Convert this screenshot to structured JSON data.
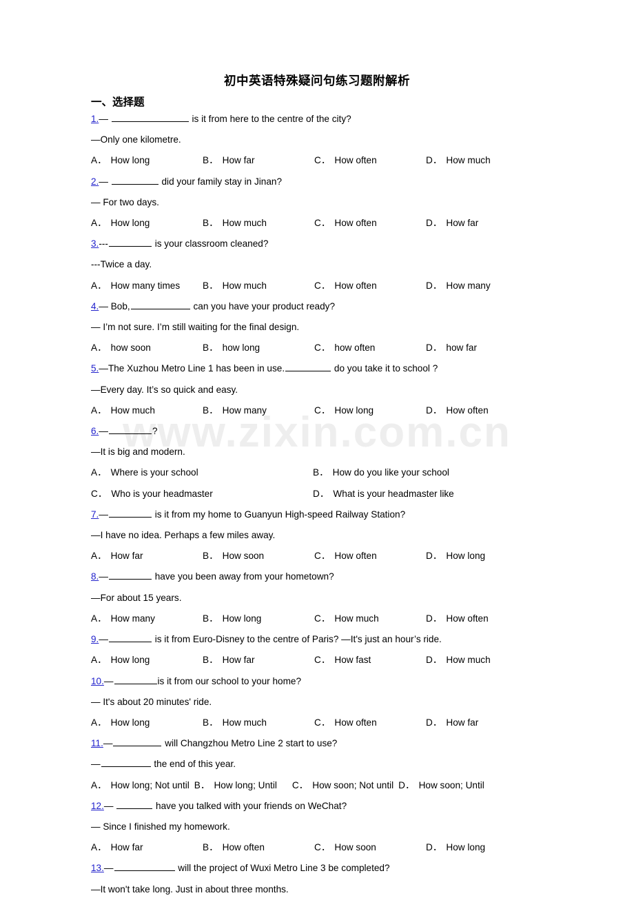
{
  "document": {
    "title": "初中英语特殊疑问句练习题附解析",
    "section_heading": "一、选择题",
    "watermark": "www.zixin.com.cn"
  },
  "questions": [
    {
      "num": "1.",
      "stem_pre": "— ",
      "stem_post": " is it from here to the centre of the city?",
      "reply": "—Only one kilometre.",
      "options": [
        {
          "label": "A．",
          "text": "How long"
        },
        {
          "label": "B．",
          "text": "How far"
        },
        {
          "label": "C．",
          "text": "How often"
        },
        {
          "label": "D．",
          "text": "How much"
        }
      ]
    },
    {
      "num": "2.",
      "stem_pre": "— ",
      "stem_post": " did your family stay in Jinan?",
      "reply": "— For two days.",
      "options": [
        {
          "label": "A．",
          "text": "How long"
        },
        {
          "label": "B．",
          "text": "How much"
        },
        {
          "label": "C．",
          "text": "How often"
        },
        {
          "label": "D．",
          "text": "How far"
        }
      ]
    },
    {
      "num": "3.",
      "stem_pre": "---",
      "stem_post": " is your classroom cleaned?",
      "reply": "---Twice a day.",
      "options": [
        {
          "label": "A．",
          "text": "How many times"
        },
        {
          "label": "B．",
          "text": "How much"
        },
        {
          "label": "C．",
          "text": "How often"
        },
        {
          "label": "D．",
          "text": "How many"
        }
      ]
    },
    {
      "num": "4.",
      "stem_pre": "— Bob,",
      "stem_post": " can you have your product ready?",
      "reply": "— I’m not sure. I’m still waiting for the final design.",
      "options": [
        {
          "label": "A．",
          "text": "how soon"
        },
        {
          "label": "B．",
          "text": "how long"
        },
        {
          "label": "C．",
          "text": "how often"
        },
        {
          "label": "D．",
          "text": "how far"
        }
      ]
    },
    {
      "num": "5.",
      "stem_pre": "—The Xuzhou Metro Line 1 has been in use.",
      "stem_post": " do you take it to school ?",
      "reply": "—Every day. It’s so quick and easy.",
      "options": [
        {
          "label": "A．",
          "text": "How much"
        },
        {
          "label": "B．",
          "text": "How many"
        },
        {
          "label": "C．",
          "text": "How long"
        },
        {
          "label": "D．",
          "text": "How often"
        }
      ]
    },
    {
      "num": "6.",
      "stem_pre": "—",
      "stem_post": "?",
      "reply": "—It is big and modern.",
      "options": [
        {
          "label": "A．",
          "text": "Where is your school"
        },
        {
          "label": "B．",
          "text": "How do you like your school"
        },
        {
          "label": "C．",
          "text": "Who is your headmaster"
        },
        {
          "label": "D．",
          "text": "What is your headmaster like"
        }
      ]
    },
    {
      "num": "7.",
      "stem_pre": "—",
      "stem_post": " is it from my home to Guanyun High-speed Railway Station?",
      "reply": "—I have no idea. Perhaps a few miles away.",
      "options": [
        {
          "label": "A．",
          "text": "How far"
        },
        {
          "label": "B．",
          "text": "How soon"
        },
        {
          "label": "C．",
          "text": "How often"
        },
        {
          "label": "D．",
          "text": "How long"
        }
      ]
    },
    {
      "num": "8.",
      "stem_pre": "—",
      "stem_post": " have you been away from your hometown?",
      "reply": "—For about 15 years.",
      "options": [
        {
          "label": "A．",
          "text": "How many"
        },
        {
          "label": "B．",
          "text": "How long"
        },
        {
          "label": "C．",
          "text": "How much"
        },
        {
          "label": "D．",
          "text": "How often"
        }
      ]
    },
    {
      "num": "9.",
      "stem_pre": "—",
      "stem_post": " is it from Euro-Disney to the centre of Paris?  —It's just an hour’s ride.",
      "reply": "",
      "options": [
        {
          "label": "A．",
          "text": "How long"
        },
        {
          "label": "B．",
          "text": "How far"
        },
        {
          "label": "C．",
          "text": "How fast"
        },
        {
          "label": "D．",
          "text": "How much"
        }
      ]
    },
    {
      "num": "10.",
      "stem_pre": "—",
      "stem_post": "is it from our school to your home?",
      "reply": "— It's about 20 minutes' ride.",
      "options": [
        {
          "label": "A．",
          "text": "How long"
        },
        {
          "label": "B．",
          "text": "How much"
        },
        {
          "label": "C．",
          "text": "How often"
        },
        {
          "label": "D．",
          "text": "How far"
        }
      ]
    },
    {
      "num": "11.",
      "stem_pre": "—",
      "stem_post": " will Changzhou Metro Line 2 start to use?",
      "reply": "",
      "reply_pre": "—",
      "reply_post": " the end of this year.",
      "options": [
        {
          "label": "A．",
          "text": "How long; Not until"
        },
        {
          "label": "B．",
          "text": "How long; Until"
        },
        {
          "label": "C．",
          "text": "How soon; Not until"
        },
        {
          "label": "D．",
          "text": "How soon; Until"
        }
      ]
    },
    {
      "num": "12.",
      "stem_pre": "— ",
      "stem_post": " have you talked with your friends on WeChat?",
      "reply": "— Since I finished my homework.",
      "options": [
        {
          "label": "A．",
          "text": "How far"
        },
        {
          "label": "B．",
          "text": "How often"
        },
        {
          "label": "C．",
          "text": "How soon"
        },
        {
          "label": "D．",
          "text": "How long"
        }
      ]
    },
    {
      "num": "13.",
      "stem_pre": "—",
      "stem_post": " will the project of Wuxi Metro Line 3 be completed?",
      "reply": "—It won't take long. Just in about three months.",
      "options": []
    }
  ]
}
